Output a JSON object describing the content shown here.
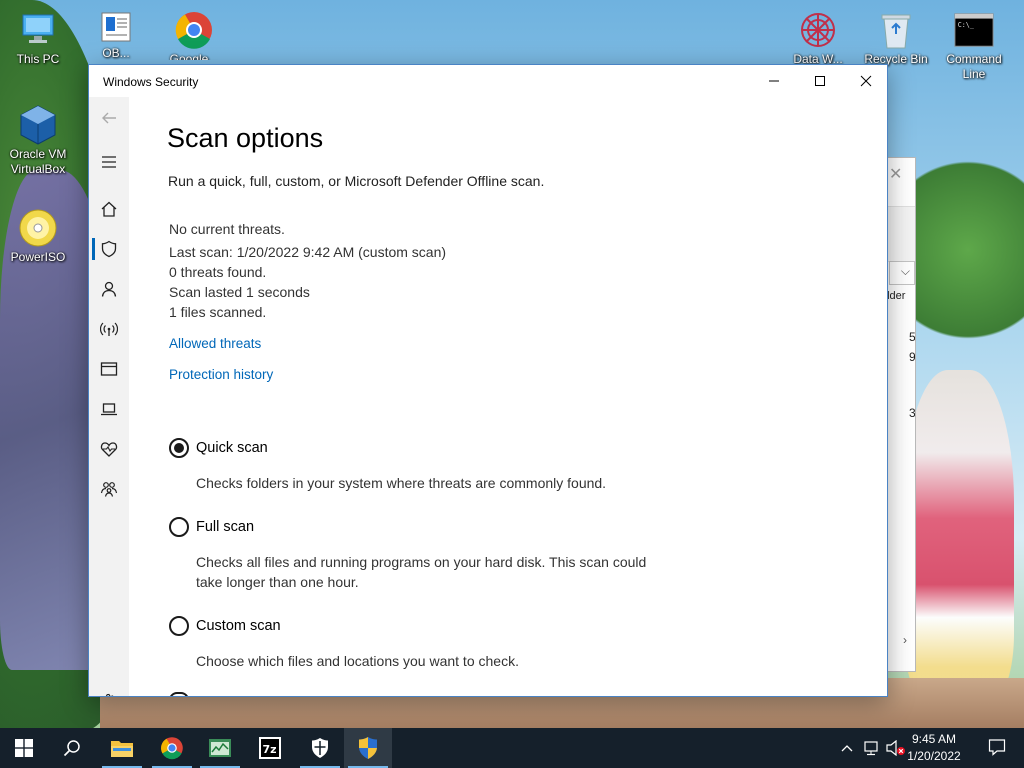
{
  "desktop": {
    "icons": [
      {
        "label": "This PC",
        "icon": "this-pc-icon"
      },
      {
        "label": "OB...",
        "icon": "notepad-icon"
      },
      {
        "label": "Google...",
        "icon": "chrome-icon"
      },
      {
        "label": "Oracle VM VirtualBox",
        "icon": "virtualbox-icon"
      },
      {
        "label": "PowerISO",
        "icon": "poweriso-icon"
      },
      {
        "label": "Data W...",
        "icon": "datawrangler-icon"
      },
      {
        "label": "Recycle Bin",
        "icon": "recycle-bin-icon"
      },
      {
        "label": "Command Line",
        "icon": "command-line-icon"
      }
    ]
  },
  "background_window": {
    "column_header": "older",
    "numbers": [
      "5",
      "9",
      "3"
    ]
  },
  "window": {
    "title": "Windows Security",
    "controls": {
      "minimize": "minimize-icon",
      "maximize": "maximize-icon",
      "close": "close-icon"
    }
  },
  "nav": {
    "items": [
      {
        "name": "back",
        "icon": "back-arrow-icon"
      },
      {
        "name": "menu",
        "icon": "hamburger-menu-icon"
      },
      {
        "name": "home",
        "icon": "home-icon"
      },
      {
        "name": "virus-threat-protection",
        "icon": "shield-icon",
        "active": true
      },
      {
        "name": "account-protection",
        "icon": "person-icon"
      },
      {
        "name": "firewall-network",
        "icon": "wireless-icon"
      },
      {
        "name": "app-browser-control",
        "icon": "browser-window-icon"
      },
      {
        "name": "device-security",
        "icon": "laptop-icon"
      },
      {
        "name": "device-performance",
        "icon": "heart-pulse-icon"
      },
      {
        "name": "family-options",
        "icon": "family-icon"
      },
      {
        "name": "settings",
        "icon": "gear-icon"
      }
    ]
  },
  "page": {
    "title": "Scan options",
    "subtitle": "Run a quick, full, custom, or Microsoft Defender Offline scan.",
    "status": {
      "threats": "No current threats.",
      "last_scan": "Last scan: 1/20/2022 9:42 AM (custom scan)",
      "found": "0 threats found.",
      "duration": "Scan lasted 1 seconds",
      "files": "1 files scanned."
    },
    "links": {
      "allowed": "Allowed threats",
      "history": "Protection history"
    },
    "options": [
      {
        "label": "Quick scan",
        "description": "Checks folders in your system where threats are commonly found.",
        "selected": true
      },
      {
        "label": "Full scan",
        "description": "Checks all files and running programs on your hard disk. This scan could take longer than one hour.",
        "selected": false
      },
      {
        "label": "Custom scan",
        "description": "Choose which files and locations you want to check.",
        "selected": false
      }
    ]
  },
  "taskbar": {
    "items": [
      "windows-start-icon",
      "search-icon",
      "file-explorer-icon",
      "chrome-icon",
      "task-manager-icon",
      "7zip-icon",
      "windows-security-icon",
      "shield-uac-icon"
    ],
    "tray_icons": [
      "chevron-up-icon",
      "network-icon",
      "volume-muted-icon",
      "notification-icon"
    ],
    "time": "9:45 AM",
    "date": "1/20/2022"
  }
}
